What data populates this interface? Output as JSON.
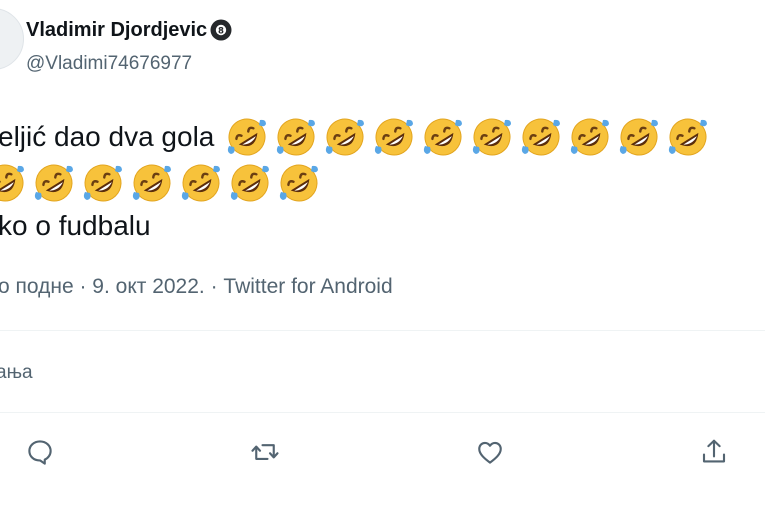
{
  "author": {
    "display_name": "Vladimir Djordjevic",
    "handle": "@Vladimi74676977",
    "badge_icon": "eight-ball-icon"
  },
  "tweet": {
    "line1_text": "eljić dao dva gola",
    "line1_emoji_count": 10,
    "line2_emoji_count": 7,
    "line3_text": "ko o fudbalu",
    "emoji_name": "rolling-on-the-floor-laughing-emoji"
  },
  "meta": {
    "text": "о подне · 9. окт 2022. · Twitter for Android"
  },
  "engagement": {
    "quotes_label": "ања"
  },
  "actions": [
    {
      "name": "reply",
      "icon": "reply-icon"
    },
    {
      "name": "retweet",
      "icon": "retweet-icon"
    },
    {
      "name": "like",
      "icon": "heart-icon"
    },
    {
      "name": "share",
      "icon": "share-icon"
    }
  ],
  "colors": {
    "text_primary": "#0f1419",
    "text_secondary": "#536471",
    "divider": "#eff3f4",
    "emoji_face": "#f7c23b",
    "emoji_tear": "#5aa7e6"
  }
}
